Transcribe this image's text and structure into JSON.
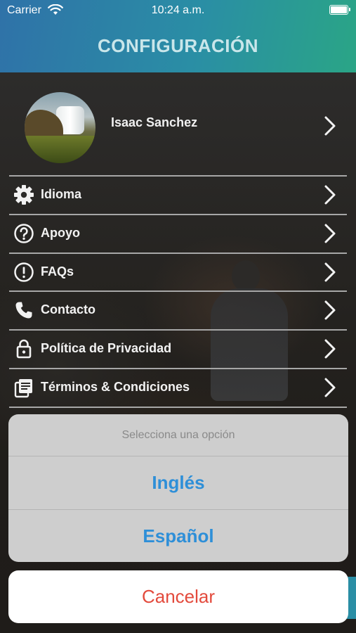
{
  "status_bar": {
    "carrier": "Carrier",
    "time": "10:24 a.m."
  },
  "header": {
    "title": "CONFIGURACIÓN"
  },
  "profile": {
    "name": "Isaac Sanchez"
  },
  "menu": {
    "items": [
      {
        "label": "Idioma",
        "icon": "gear-icon"
      },
      {
        "label": "Apoyo",
        "icon": "question-circle-icon"
      },
      {
        "label": "FAQs",
        "icon": "exclamation-circle-icon"
      },
      {
        "label": "Contacto",
        "icon": "phone-icon"
      },
      {
        "label": "Política de Privacidad",
        "icon": "lock-icon"
      },
      {
        "label": "Términos & Condiciones",
        "icon": "document-icon"
      }
    ]
  },
  "action_sheet": {
    "title": "Selecciona una opción",
    "options": [
      "Inglés",
      "Español"
    ],
    "cancel": "Cancelar"
  },
  "colors": {
    "header_gradient_start": "#2f72a8",
    "header_gradient_end": "#2aa586",
    "action_blue": "#2e8fd8",
    "cancel_red": "#e34a3c"
  }
}
